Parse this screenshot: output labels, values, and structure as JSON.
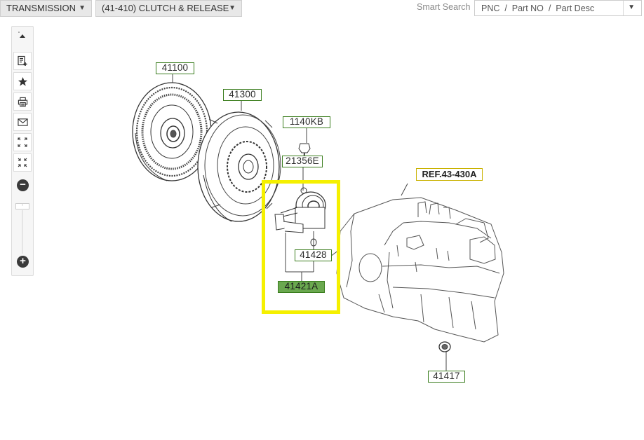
{
  "topbar": {
    "category_dropdown": "TRANSMISSION",
    "group_dropdown": "(41-410) CLUTCH & RELEASE",
    "smart_search_label": "Smart Search",
    "search_placeholder": "PNC  /  Part NO  /  Part Desc"
  },
  "toolbar": {
    "icons": [
      "scroll-up-icon",
      "add-to-list-icon",
      "star-icon",
      "print-icon",
      "mail-icon",
      "expand-icon",
      "collapse-icon",
      "zoom-out-icon",
      "zoom-slider",
      "zoom-in-icon"
    ],
    "zoom_handle": "-",
    "zoom_out": "−",
    "zoom_in": "+"
  },
  "diagram": {
    "parts": [
      "41100",
      "41300",
      "1140KB",
      "21356E",
      "41428",
      "41421A",
      "41417"
    ],
    "selected_part": "41421A",
    "reference": "REF.43-430A",
    "highlight_color": "#f5f000",
    "label_border_color": "#3a7d1d",
    "selected_fill_color": "#6aa84f"
  }
}
